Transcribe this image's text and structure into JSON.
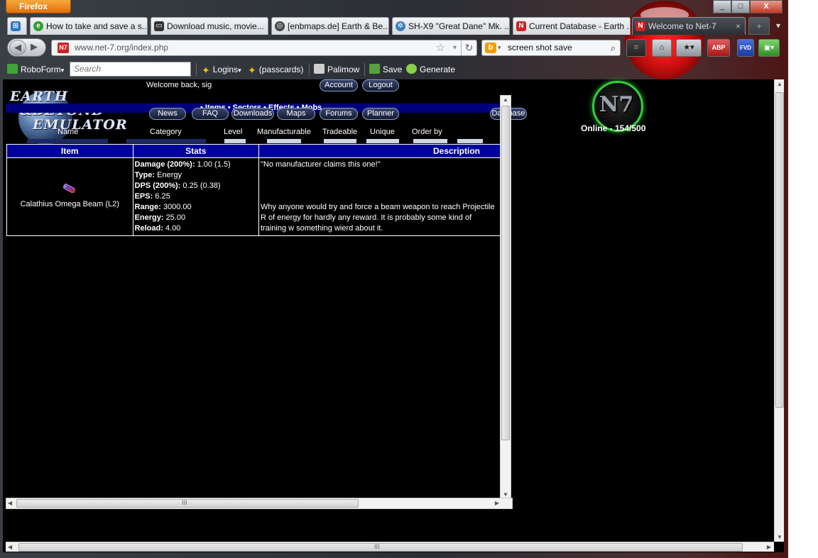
{
  "browser": {
    "menu_label": "Firefox",
    "window_controls": {
      "minimize": "_",
      "maximize": "□",
      "close": "X"
    },
    "tabs": [
      {
        "label": "",
        "icon": "windows-logo-icon",
        "color": "#2a76c6"
      },
      {
        "label": "How to take and save a s...",
        "icon": "e-icon",
        "color": "#2ea02e"
      },
      {
        "label": "Download music, movie...",
        "icon": "monitor-icon",
        "color": "#333333"
      },
      {
        "label": "[enbmaps.de] Earth & Be...",
        "icon": "target-icon",
        "color": "#444444"
      },
      {
        "label": "SH-X9 \"Great Dane\" Mk. ...",
        "icon": "gear-icon",
        "color": "#3a7fbf"
      },
      {
        "label": "Current Database - Earth ...",
        "icon": "n7-icon",
        "color": "#cc2222"
      },
      {
        "label": "Welcome to Net-7",
        "icon": "n7-icon",
        "color": "#cc2222"
      }
    ],
    "tab_close": "×",
    "new_tab": "+",
    "url": "www.net-7.org/index.php",
    "search_engine_query": "screen shot save"
  },
  "robobar": {
    "robo_label": "RoboForm",
    "search_placeholder": "Search",
    "logins": "Logins",
    "passcards": "(passcards)",
    "palimow": "Palimow",
    "save": "Save",
    "generate": "Generate"
  },
  "site": {
    "logo_lines": [
      "EARTH",
      "&BEYOND",
      "EMULATOR"
    ],
    "welcome": "Welcome back, sig",
    "account": "Account",
    "logout": "Logout",
    "subnav": "• Items • Sectors • Effects • Mobs",
    "nav": [
      "News",
      "FAQ",
      "Downloads",
      "Maps",
      "Forums",
      "Planner"
    ],
    "database": "Database",
    "online": "Online - 154/500",
    "n7_logo": "N7",
    "filters": [
      "Name",
      "Category",
      "Level",
      "Manufacturable",
      "Tradeable",
      "Unique",
      "Order by"
    ]
  },
  "table": {
    "headers": [
      "Item",
      "Stats",
      "Description"
    ],
    "rows": [
      {
        "item_name": "Calathius Omega Beam (L2)",
        "stats": [
          {
            "label": "Damage (200%):",
            "value": "1.00 (1.5)"
          },
          {
            "label": "Type:",
            "value": "Energy"
          },
          {
            "label": "DPS (200%):",
            "value": "0.25 (0.38)"
          },
          {
            "label": "EPS:",
            "value": "6.25"
          },
          {
            "label": "Range:",
            "value": "3000.00"
          },
          {
            "label": "Energy:",
            "value": "25.00"
          },
          {
            "label": "Reload:",
            "value": "4.00"
          }
        ],
        "manufacturer": "\"No manufacturer claims this one!\"",
        "description": "Why anyone would try and force a beam weapon to reach Projectile R of energy for hardly any reward. It is probably some kind of training w something wierd about it."
      }
    ]
  },
  "scrollbar_grip": "III"
}
